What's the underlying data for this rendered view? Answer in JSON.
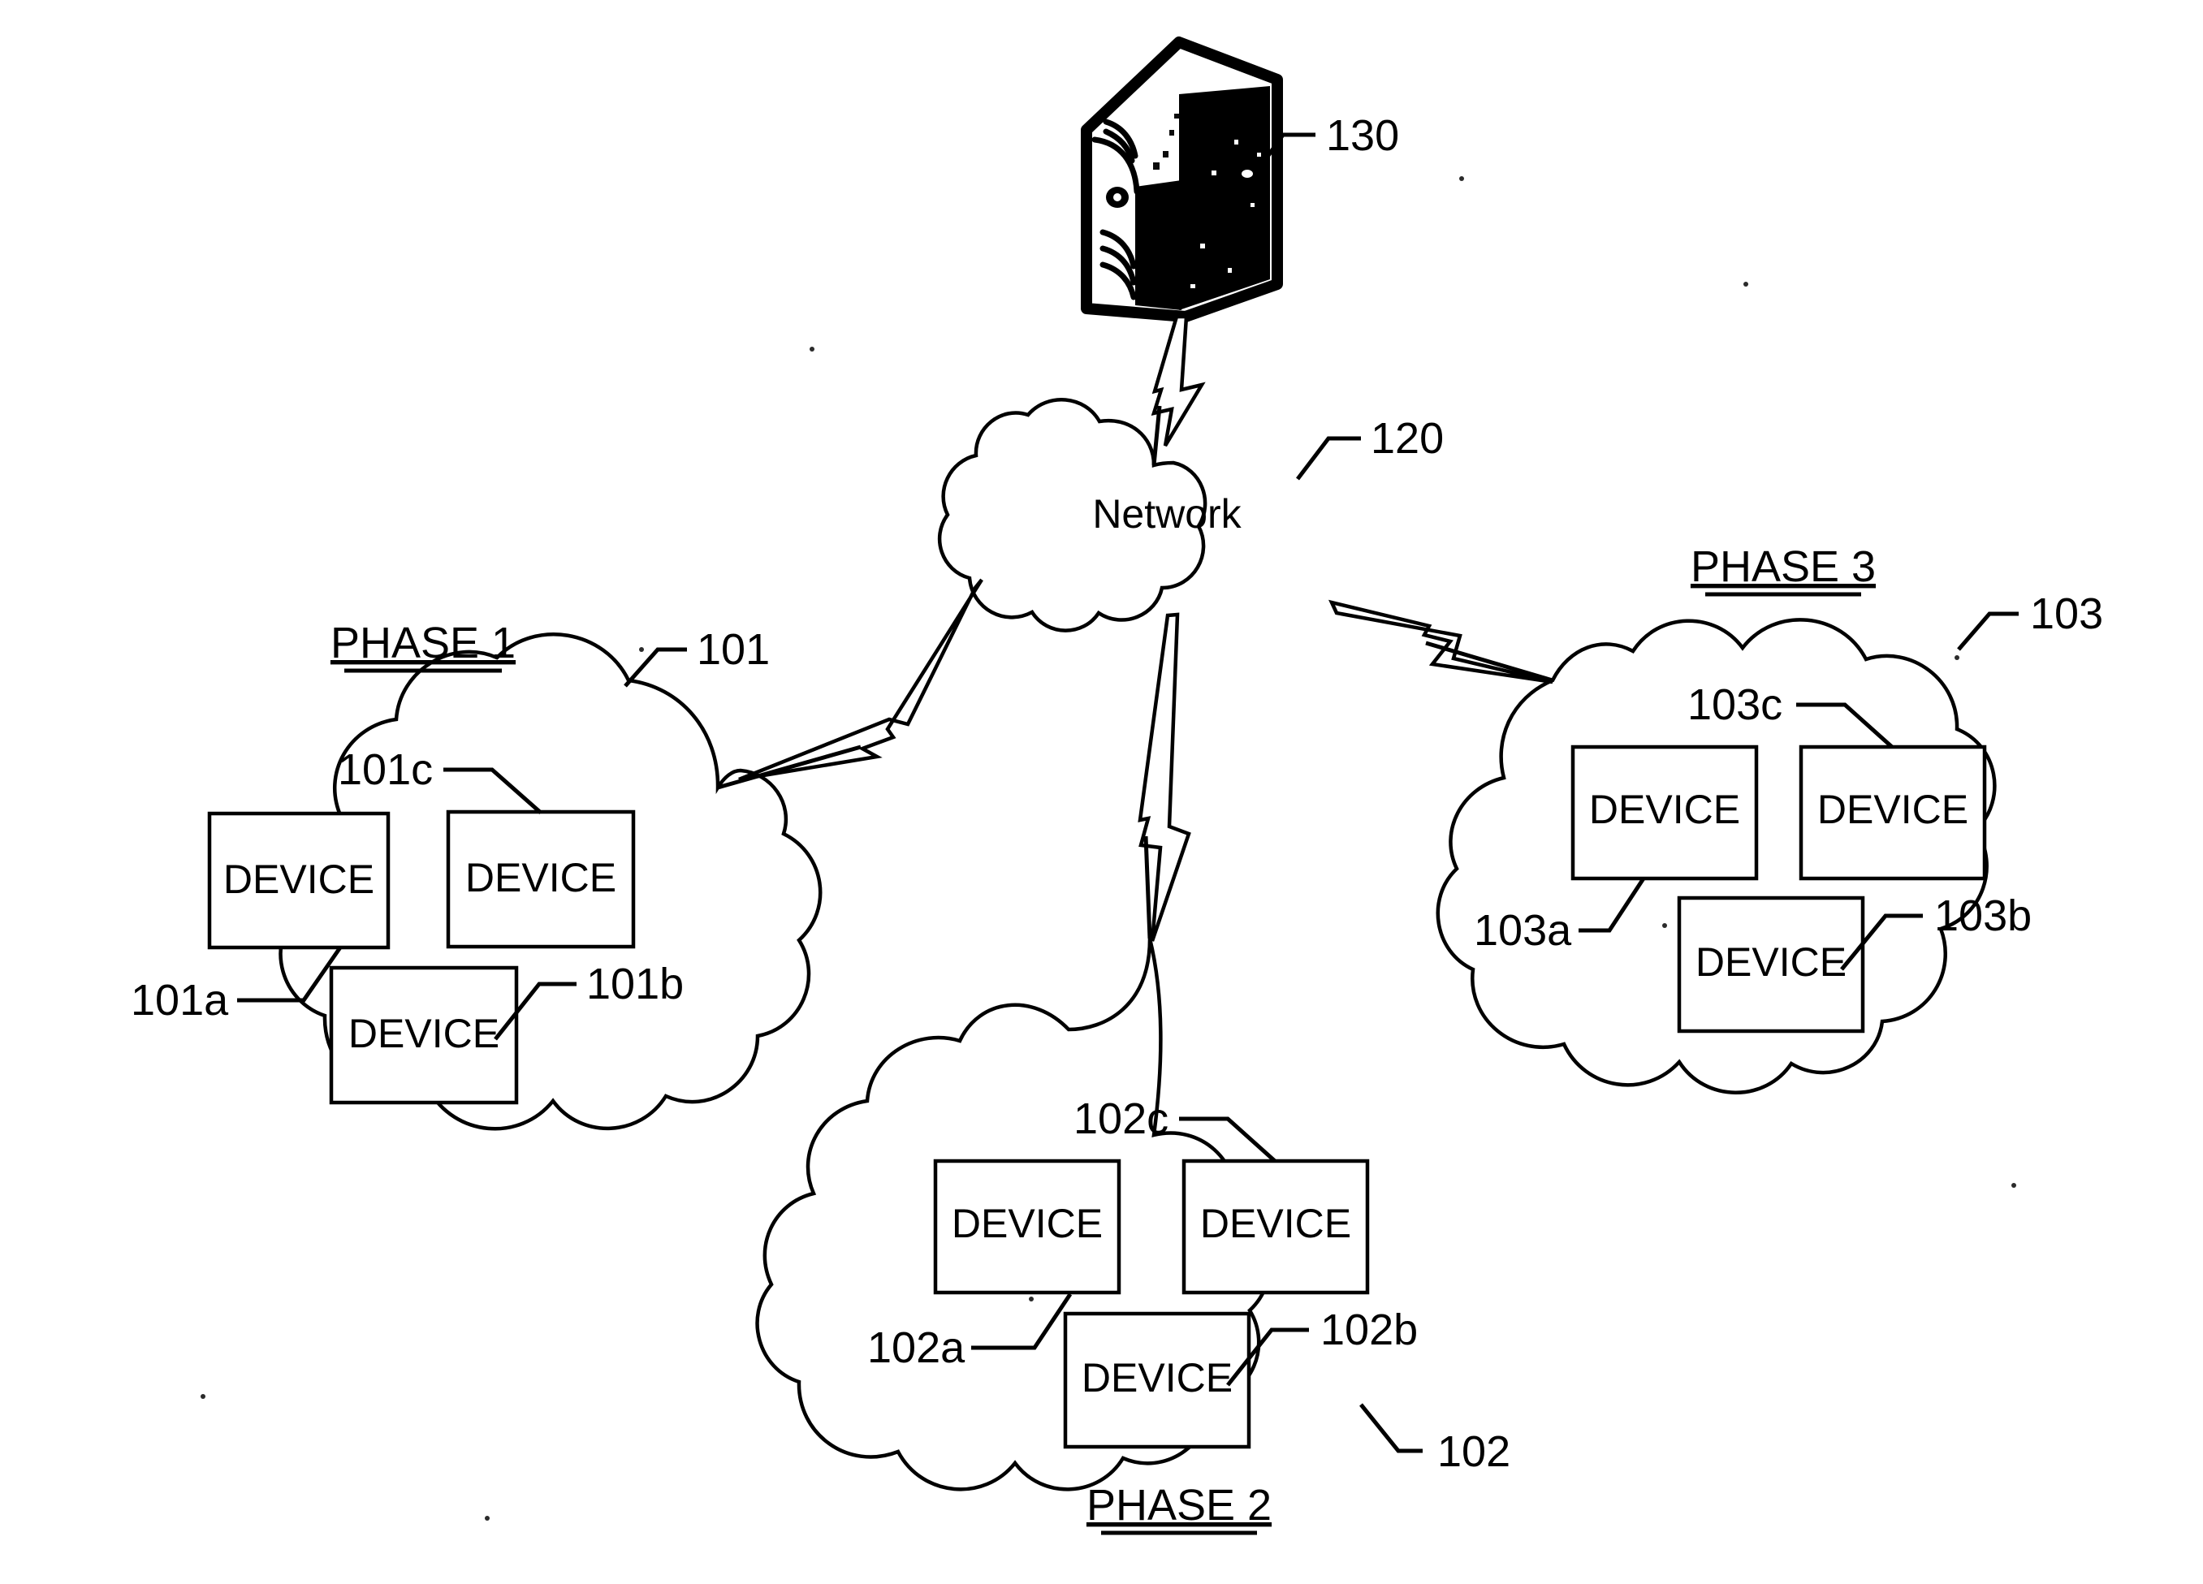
{
  "diagram": {
    "type": "network-architecture-diagram",
    "server": {
      "ref": "130",
      "icon": "server-tower-icon"
    },
    "network": {
      "label": "Network",
      "ref": "120",
      "icon": "cloud-icon"
    },
    "device_label": "DEVICE",
    "phases": [
      {
        "title": "PHASE 1",
        "ref": "101",
        "devices": [
          {
            "ref": "101a",
            "label": "DEVICE"
          },
          {
            "ref": "101c",
            "label": "DEVICE"
          },
          {
            "ref": "101b",
            "label": "DEVICE"
          }
        ]
      },
      {
        "title": "PHASE 2",
        "ref": "102",
        "devices": [
          {
            "ref": "102a",
            "label": "DEVICE"
          },
          {
            "ref": "102c",
            "label": "DEVICE"
          },
          {
            "ref": "102b",
            "label": "DEVICE"
          }
        ]
      },
      {
        "title": "PHASE 3",
        "ref": "103",
        "devices": [
          {
            "ref": "103a",
            "label": "DEVICE"
          },
          {
            "ref": "103c",
            "label": "DEVICE"
          },
          {
            "ref": "103b",
            "label": "DEVICE"
          }
        ]
      }
    ],
    "connectors": [
      {
        "from": "130",
        "to": "120",
        "style": "lightning-bolt"
      },
      {
        "from": "120",
        "to": "101",
        "style": "lightning-bolt"
      },
      {
        "from": "120",
        "to": "102",
        "style": "lightning-bolt"
      },
      {
        "from": "120",
        "to": "103",
        "style": "lightning-bolt"
      }
    ],
    "colors": {
      "ink": "#000000",
      "paper": "#ffffff"
    }
  }
}
